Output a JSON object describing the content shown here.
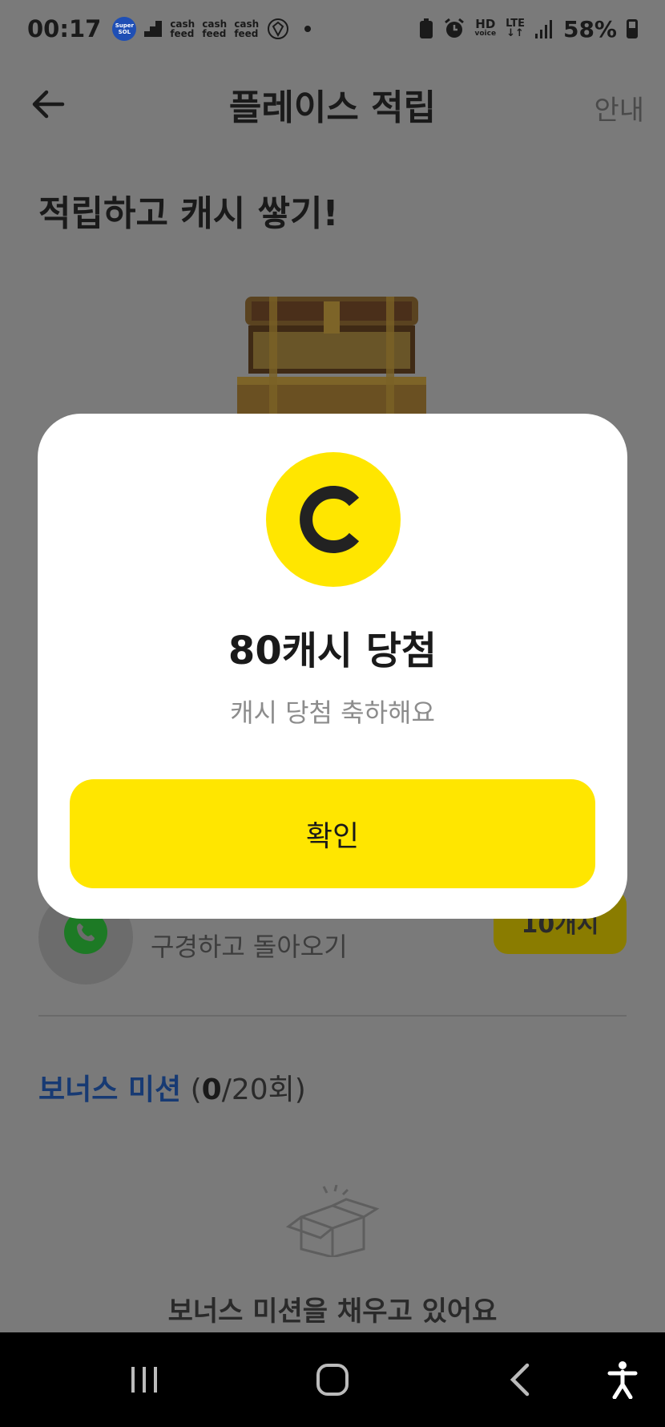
{
  "status_bar": {
    "time": "00:17",
    "sol_badge": "Super SOL",
    "cashfeed_label": "cash feed",
    "battery": "58%",
    "hd_label": "HD",
    "voice_label": "voice",
    "lte_label": "LTE"
  },
  "header": {
    "title": "플레이스 적립",
    "guide_label": "안내"
  },
  "hero": {
    "title": "적립하고 캐시 쌓기!"
  },
  "mission": {
    "description": "구경하고 돌아오기",
    "badge": "10개시"
  },
  "bonus": {
    "title": "보너스 미션",
    "count_prefix": "(",
    "count_current": "0",
    "count_suffix": "/20회)",
    "empty_text": "보너스 미션을 채우고 있어요"
  },
  "dialog": {
    "coin_letter": "C",
    "title": "80캐시 당첨",
    "subtitle": "캐시 당첨 축하해요",
    "confirm_label": "확인"
  },
  "colors": {
    "accent_yellow": "#ffe600",
    "bonus_blue": "#173a73",
    "dim_background": "#7a7a7a"
  }
}
